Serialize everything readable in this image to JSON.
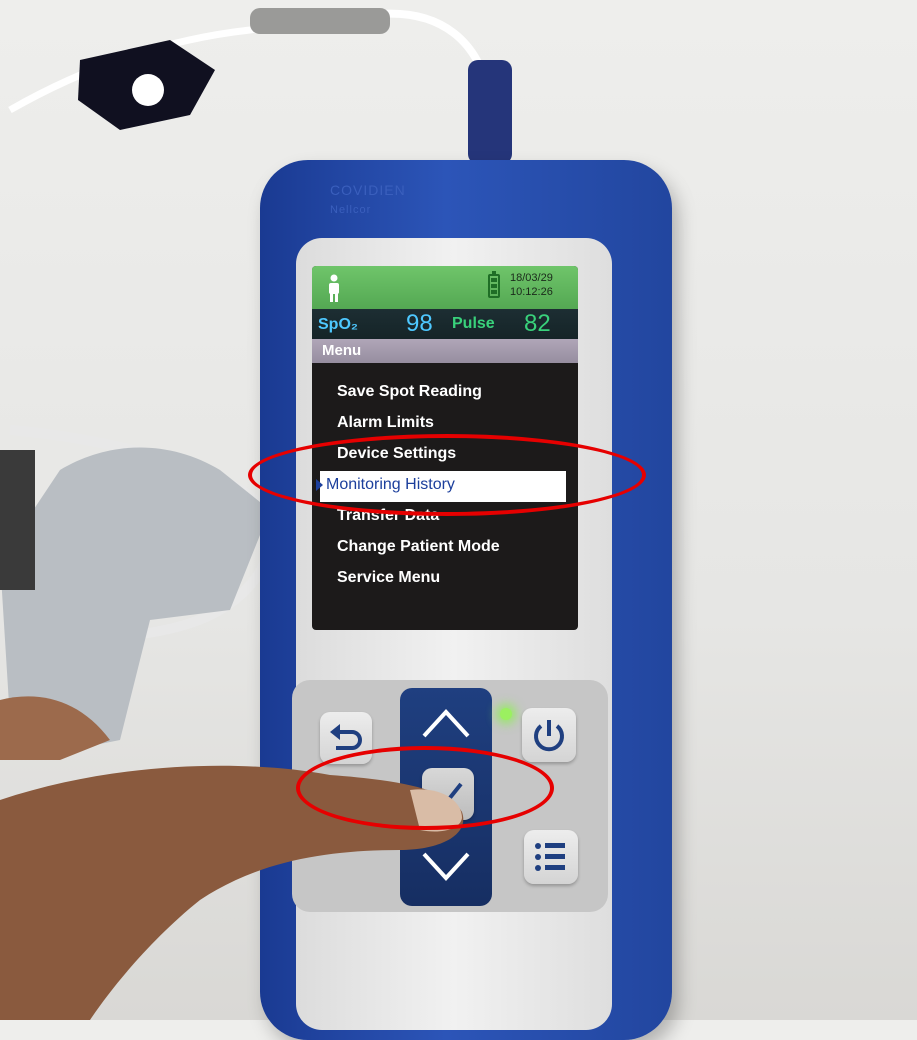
{
  "device": {
    "brand": "COVIDIEN",
    "sub_brand": "Nellcor",
    "status": {
      "date": "18/03/29",
      "time": "10:12:26",
      "patient_icon": "adult-patient-icon",
      "battery_icon": "battery-icon"
    },
    "readings": {
      "spo2_label": "SpO₂",
      "spo2_value": "98",
      "pulse_label": "Pulse",
      "pulse_value": "82",
      "spo2_color": "#4ec8ff",
      "pulse_color": "#39d17b"
    },
    "menu": {
      "title": "Menu",
      "items": [
        {
          "label": "Save Spot Reading",
          "selected": false
        },
        {
          "label": "Alarm Limits",
          "selected": false
        },
        {
          "label": "Device Settings",
          "selected": false
        },
        {
          "label": "Monitoring History",
          "selected": true
        },
        {
          "label": "Transfer Data",
          "selected": false
        },
        {
          "label": "Change Patient Mode",
          "selected": false
        },
        {
          "label": "Service Menu",
          "selected": false
        }
      ]
    },
    "keypad": {
      "back": "back-arrow-icon",
      "up": "chevron-up-icon",
      "select": "checkmark-icon",
      "down": "chevron-down-icon",
      "power": "power-icon",
      "menu": "list-menu-icon"
    },
    "housing_color": "#22469f",
    "annotation_color": "#e60000"
  }
}
